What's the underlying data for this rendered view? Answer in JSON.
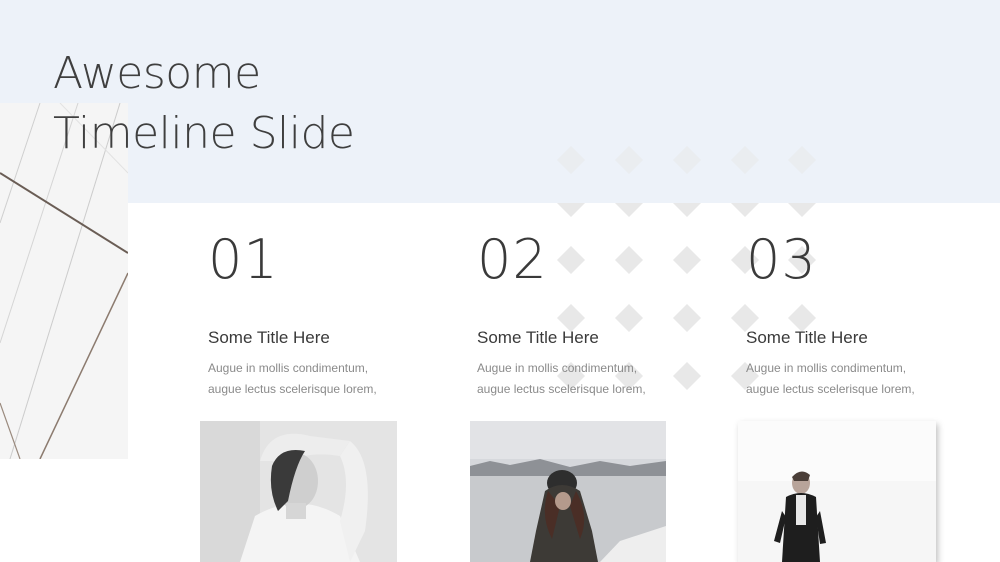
{
  "slide": {
    "title_line1": "Awesome",
    "title_line2": "Timeline Slide"
  },
  "colors": {
    "top_band": "#edf2f9",
    "text_dark": "#3a3a3a",
    "text_muted": "#8a8a8a",
    "diamond": "#e9e9e9"
  },
  "columns": [
    {
      "number": "01",
      "title": "Some Title Here",
      "body_line1": "Augue in mollis condimentum,",
      "body_line2": "augue lectus scelerisque lorem,"
    },
    {
      "number": "02",
      "title": "Some Title Here",
      "body_line1": "Augue in mollis condimentum,",
      "body_line2": "augue lectus scelerisque lorem,"
    },
    {
      "number": "03",
      "title": "Some Title Here",
      "body_line1": "Augue in mollis condimentum,",
      "body_line2": "augue lectus scelerisque lorem,"
    }
  ],
  "photos": [
    {
      "name": "woman-turtleneck-photo"
    },
    {
      "name": "woman-winter-beanie-photo"
    },
    {
      "name": "man-winter-coat-photo"
    }
  ]
}
